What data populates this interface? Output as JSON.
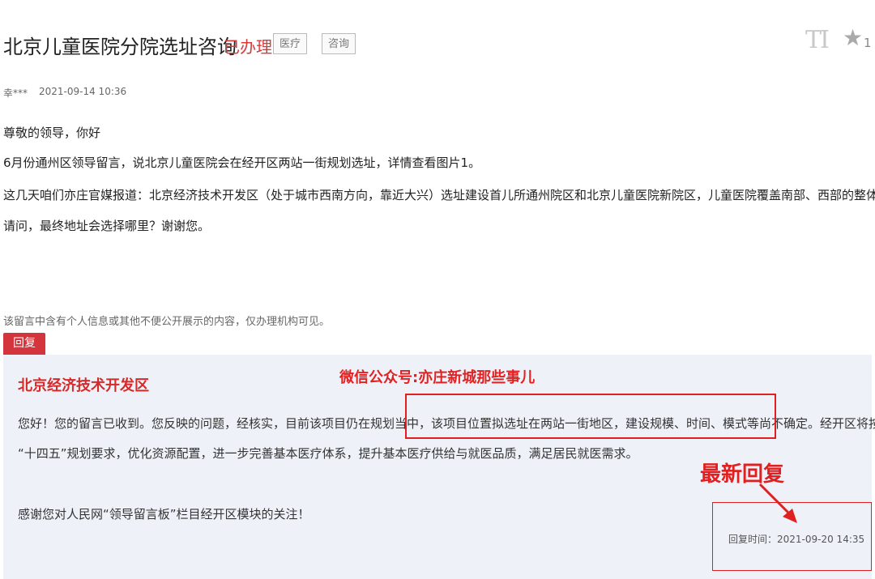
{
  "header": {
    "title": "北京儿童医院分院选址咨询",
    "status": "已办理",
    "tags": [
      "医疗",
      "咨询"
    ],
    "font_size_icon": "T",
    "favorite_icon": "star-icon",
    "favorite_count": "1"
  },
  "meta": {
    "author": "幸***",
    "date": "2021-09-14 10:36"
  },
  "message": {
    "lines": [
      "尊敬的领导，你好",
      "6月份通州区领导留言，说北京儿童医院会在经开区两站一街规划选址，详情查看图片1。",
      "这几天咱们亦庄官媒报道：北京经济技术开发区（处于城市西南方向，靠近大兴）选址建设首儿所通州院区和北京儿童医院新院区，儿童医院覆盖南部、西部的整体布局；",
      "请问，最终地址会选择哪里？谢谢您。"
    ],
    "privacy_notice": "该留言中含有个人信息或其他不便公开展示的内容，仅办理机构可见。"
  },
  "reply": {
    "button_label": "回复",
    "org": "北京经济技术开发区",
    "watermark": "微信公众号:亦庄新城那些事儿",
    "line1_a": "您好！您的留言已收到。您反映的问题，经核实，目前该项目仍在规划当中，",
    "line1_b": "该项目位置拟选址在两站一街地区，建设规模、时间、模式等尚不确定。",
    "line1_c": "经开区将按照",
    "line2": "“十四五”规划要求，优化资源配置，进一步完善基本医疗体系，提升基本医疗供给与就医品质，满足居民就医需求。",
    "line3": "感谢您对人民网“领导留言板”栏目经开区模块的关注！",
    "annotation": "最新回复",
    "time": "回复时间：2021-09-20 14:35"
  },
  "colors": {
    "accent_red": "#d4343c",
    "annotation_red": "#e02020",
    "panel_bg": "#eef2f8"
  }
}
